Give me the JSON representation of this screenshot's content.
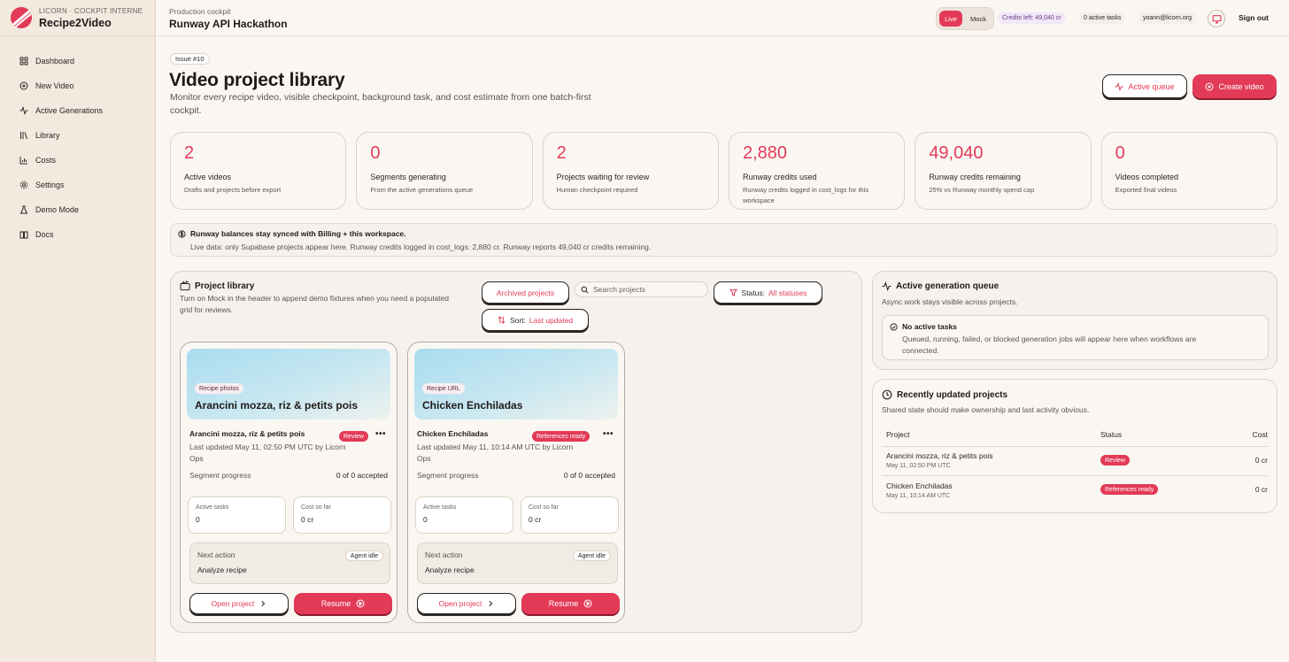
{
  "brand": {
    "subtitle": "LICORN · COCKPIT INTERNE",
    "name": "Recipe2Video"
  },
  "sidebar": {
    "items": [
      {
        "label": "Dashboard",
        "icon": "grid-icon"
      },
      {
        "label": "New Video",
        "icon": "plus-circle-icon"
      },
      {
        "label": "Active Generations",
        "icon": "activity-icon"
      },
      {
        "label": "Library",
        "icon": "library-icon"
      },
      {
        "label": "Costs",
        "icon": "bar-chart-icon"
      },
      {
        "label": "Settings",
        "icon": "gear-icon"
      },
      {
        "label": "Demo Mode",
        "icon": "flask-icon"
      },
      {
        "label": "Docs",
        "icon": "book-icon"
      }
    ]
  },
  "header": {
    "breadcrumb": "Production cockpit",
    "title": "Runway API Hackathon",
    "mode_live": "Live",
    "mode_mock": "Mock",
    "credits_left": "Credits left: 49,040 cr",
    "active_tasks": "0 active tasks",
    "user_email": "yoann@licorn.org",
    "sign_out": "Sign out"
  },
  "page": {
    "issue": "Issue #10",
    "title": "Video project library",
    "description": "Monitor every recipe video, visible checkpoint, background task, and cost estimate from one batch-first cockpit.",
    "active_queue_label": "Active queue",
    "create_video_label": "Create video"
  },
  "stats": [
    {
      "value": "2",
      "label": "Active videos",
      "sub": "Drafts and projects before export"
    },
    {
      "value": "0",
      "label": "Segments generating",
      "sub": "From the active generations queue"
    },
    {
      "value": "2",
      "label": "Projects waiting for review",
      "sub": "Human checkpoint required"
    },
    {
      "value": "2,880",
      "label": "Runway credits used",
      "sub": "Runway credits logged in cost_logs for this workspace"
    },
    {
      "value": "49,040",
      "label": "Runway credits remaining",
      "sub": "25% vs Runway monthly spend cap"
    },
    {
      "value": "0",
      "label": "Videos completed",
      "sub": "Exported final videos"
    }
  ],
  "notice": {
    "title": "Runway balances stay synced with Billing + this workspace.",
    "body": "Live data: only Supabase projects appear here. Runway credits logged in cost_logs: 2,880 cr. Runway reports 49,040 cr credits remaining."
  },
  "library": {
    "title": "Project library",
    "subtitle": "Turn on Mock in the header to append demo fixtures when you need a populated grid for reviews.",
    "archived_label": "Archived projects",
    "search_placeholder": "Search projects",
    "status_label": "Status:",
    "status_value": "All statuses",
    "sort_label": "Sort:",
    "sort_value": "Last updated",
    "cards": [
      {
        "source_tag": "Recipe photos",
        "thumb_title": "Arancini mozza, riz & petits pois",
        "name": "Arancini mozza, riz & petits pois",
        "badge": "Review",
        "meta": "Last updated May 11, 02:50 PM UTC by Licorn Ops",
        "segment_label": "Segment progress",
        "segment_value": "0 of 0 accepted",
        "active_tasks_label": "Active tasks",
        "active_tasks_value": "0",
        "cost_label": "Cost so far",
        "cost_value": "0 cr",
        "next_label": "Next action",
        "next_value": "Analyze recipe",
        "agent_status": "Agent idle",
        "open_label": "Open project",
        "resume_label": "Resume"
      },
      {
        "source_tag": "Recipe URL",
        "thumb_title": "Chicken Enchiladas",
        "name": "Chicken Enchiladas",
        "badge": "References ready",
        "meta": "Last updated May 11, 10:14 AM UTC by Licorn Ops",
        "segment_label": "Segment progress",
        "segment_value": "0 of 0 accepted",
        "active_tasks_label": "Active tasks",
        "active_tasks_value": "0",
        "cost_label": "Cost so far",
        "cost_value": "0 cr",
        "next_label": "Next action",
        "next_value": "Analyze recipe",
        "agent_status": "Agent idle",
        "open_label": "Open project",
        "resume_label": "Resume"
      }
    ]
  },
  "queue": {
    "title": "Active generation queue",
    "subtitle": "Async work stays visible across projects.",
    "empty_title": "No active tasks",
    "empty_body": "Queued, running, failed, or blocked generation jobs will appear here when workflows are connected."
  },
  "recent": {
    "title": "Recently updated projects",
    "subtitle": "Shared state should make ownership and last activity obvious.",
    "columns": {
      "project": "Project",
      "status": "Status",
      "cost": "Cost"
    },
    "rows": [
      {
        "name": "Arancini mozza, riz & petits pois",
        "date": "May 11, 02:50 PM UTC",
        "status": "Review",
        "cost": "0 cr"
      },
      {
        "name": "Chicken Enchiladas",
        "date": "May 11, 10:14 AM UTC",
        "status": "References ready",
        "cost": "0 cr"
      }
    ]
  },
  "colors": {
    "accent": "#e23a57",
    "background": "#faf7f2",
    "sidebar": "#f3e9df"
  }
}
